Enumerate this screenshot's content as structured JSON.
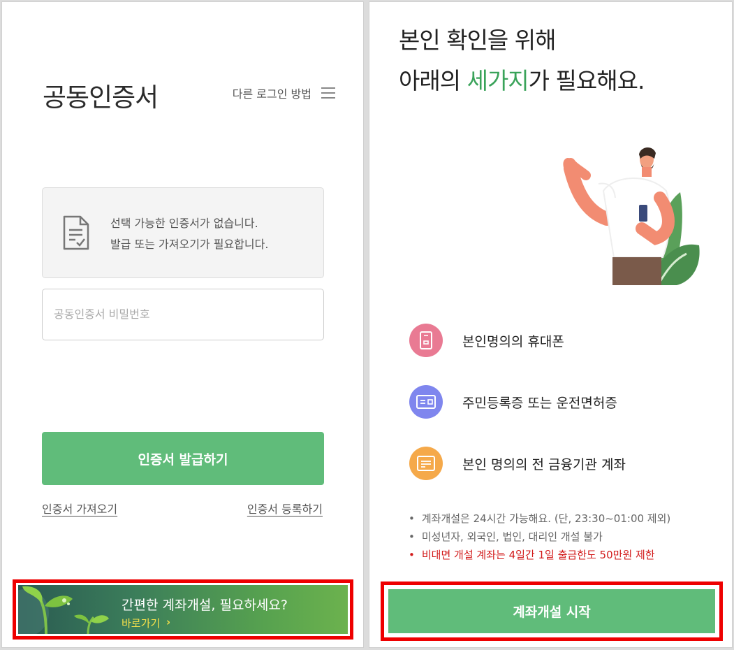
{
  "login": {
    "title": "공동인증서",
    "other_login_label": "다른 로그인 방법",
    "empty_message_line1": "선택 가능한 인증서가 없습니다.",
    "empty_message_line2": "발급 또는 가져오기가 필요합니다.",
    "password_placeholder": "공동인증서 비밀번호",
    "issue_button": "인증서 발급하기",
    "import_link": "인증서 가져오기",
    "register_link": "인증서 등록하기",
    "banner": {
      "title": "간편한 계좌개설, 필요하세요?",
      "link": "바로가기",
      "arrow": "›"
    }
  },
  "account": {
    "headline_line1": "본인 확인을 위해",
    "headline_line2_pre": "아래의 ",
    "headline_line2_highlight": "세가지",
    "headline_line2_post": "가 필요해요.",
    "requirements": [
      {
        "label": "본인명의의 휴대폰",
        "icon": "phone-icon",
        "color": "#e97a93"
      },
      {
        "label": "주민등록증 또는 운전면허증",
        "icon": "id-card-icon",
        "color": "#7f86ee"
      },
      {
        "label": "본인 명의의 전 금융기관 계좌",
        "icon": "bank-account-icon",
        "color": "#f5a94a"
      }
    ],
    "notes": [
      "계좌개설은 24시간 가능해요. (단, 23:30~01:00 제외)",
      "미성년자, 외국인, 법인, 대리인 개설 불가"
    ],
    "warning": "비대면 개설 계좌는 4일간 1일 출금한도 50만원 제한",
    "bullet": "•",
    "start_button": "계좌개설 시작"
  },
  "colors": {
    "accent_green": "#60bc7a",
    "highlight_green": "#3aa35a",
    "warning_red": "#d21a1a",
    "outline_red": "#ee0000"
  }
}
